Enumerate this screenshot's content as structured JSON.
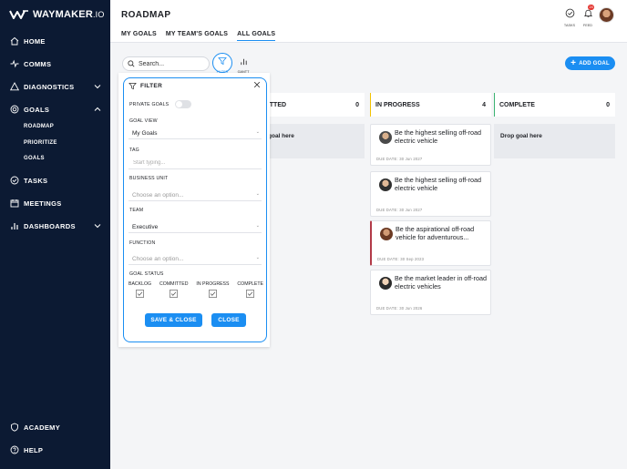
{
  "brand": {
    "name": "WAYMAKER",
    "suffix": ".IO"
  },
  "sidebar": {
    "items": [
      {
        "label": "HOME",
        "icon": "home-icon"
      },
      {
        "label": "COMMS",
        "icon": "pulse-icon"
      },
      {
        "label": "DIAGNOSTICS",
        "icon": "triangle-icon"
      },
      {
        "label": "GOALS",
        "icon": "target-icon"
      },
      {
        "label": "TASKS",
        "icon": "check-circle-icon"
      },
      {
        "label": "MEETINGS",
        "icon": "calendar-icon"
      },
      {
        "label": "DASHBOARDS",
        "icon": "bar-chart-icon"
      },
      {
        "label": "ACADEMY",
        "icon": "shield-icon"
      },
      {
        "label": "HELP",
        "icon": "help-circle-icon"
      }
    ],
    "goals_sub": [
      "ROADMAP",
      "PRIORITIZE",
      "GOALS"
    ]
  },
  "header": {
    "title": "ROADMAP",
    "tabs": [
      "MY GOALS",
      "MY TEAM'S GOALS",
      "ALL GOALS"
    ],
    "active_tab": "ALL GOALS",
    "tasks_label": "TASKS",
    "feed_label": "FEED",
    "feed_badge": "24"
  },
  "toolbar": {
    "search_placeholder": "Search...",
    "filter_label": "FILTER",
    "gantt_label": "GANTT",
    "add_goal_label": "ADD GOAL"
  },
  "columns": [
    {
      "name": "MITTED",
      "count": "0",
      "accent": "#cccccc",
      "drop_text": "goal here"
    },
    {
      "name": "IN PROGRESS",
      "count": "4",
      "accent": "#f2c200"
    },
    {
      "name": "COMPLETE",
      "count": "0",
      "accent": "#3cb371",
      "drop_text": "Drop goal here"
    }
  ],
  "cards": [
    {
      "title": "Be the highest selling off-road electric vehicle",
      "due": "DUE DATE: 30 Jun 2027"
    },
    {
      "title": "Be the highest selling off-road electric vehicle",
      "due": "DUE DATE: 30 Jun 2027"
    },
    {
      "title": "Be the aspirational off-road vehicle for adventurous...",
      "due": "DUE DATE: 30 Sep 2023"
    },
    {
      "title": "Be the market leader in off-road electric vehicles",
      "due": "DUE DATE: 30 Jun 2026"
    }
  ],
  "filter": {
    "title": "FILTER",
    "private_goals_label": "PRIVATE GOALS",
    "goal_view_label": "GOAL VIEW",
    "goal_view_value": "My Goals",
    "tag_label": "TAG",
    "tag_placeholder": "Start typing...",
    "business_unit_label": "BUSINESS UNIT",
    "business_unit_placeholder": "Choose an option...",
    "team_label": "TEAM",
    "team_value": "Executive",
    "function_label": "FUNCTION",
    "function_placeholder": "Choose an option...",
    "goal_status_label": "GOAL STATUS",
    "statuses": [
      "BACKLOG",
      "COMMITTED",
      "IN PROGRESS",
      "COMPLETE"
    ],
    "save_label": "SAVE & CLOSE",
    "close_label": "CLOSE"
  }
}
